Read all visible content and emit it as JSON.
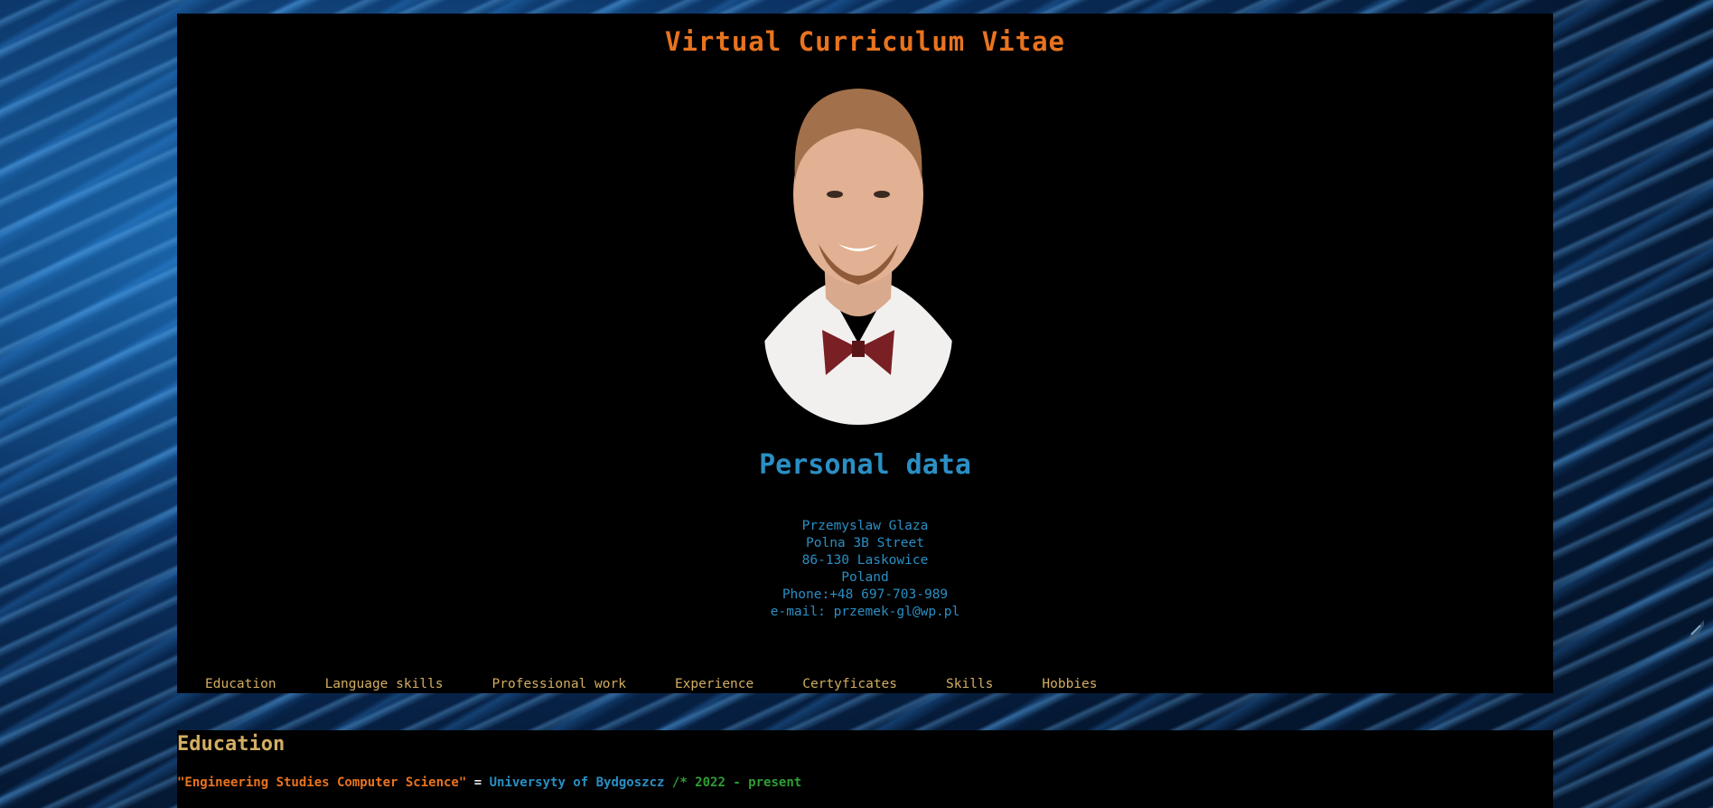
{
  "header": {
    "title": "Virtual Curriculum Vitae"
  },
  "personal": {
    "heading": "Personal data",
    "lines": [
      "Przemyslaw Glaza",
      "Polna 3B Street",
      "86-130 Laskowice",
      "Poland",
      "Phone:+48 697-703-989",
      "e-mail: przemek-gl@wp.pl"
    ]
  },
  "nav": {
    "items": [
      "Education",
      "Language skills",
      "Professional work",
      "Experience",
      "Certyficates",
      "Skills",
      "Hobbies"
    ]
  },
  "education": {
    "title": "Education",
    "entry": {
      "degree": "\"Engineering Studies Computer Science\"",
      "operator": " = ",
      "school": "Universyty of Bydgoszcz",
      "period": " /* 2022 - present"
    }
  },
  "colors": {
    "title": "#e8731f",
    "personal": "#2a8fc4",
    "nav": "#d3ae63",
    "comment": "#2f9d33"
  },
  "icons": {
    "portrait": "portrait-photo",
    "edge": "feather-icon"
  }
}
